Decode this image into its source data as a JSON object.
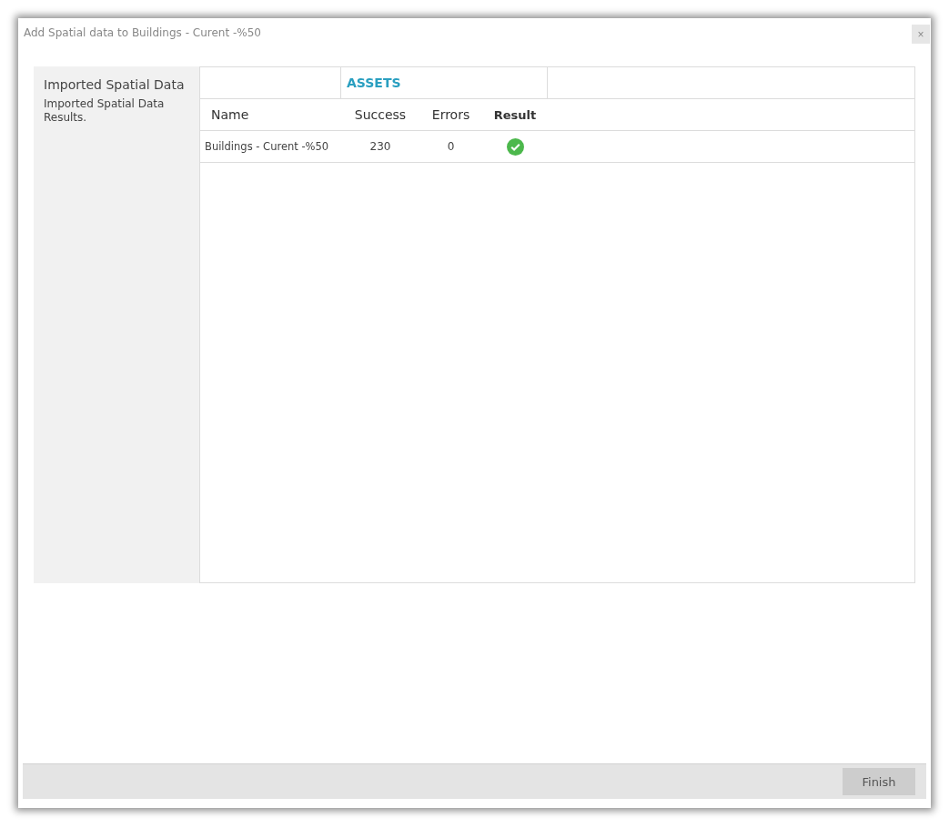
{
  "window": {
    "title": "Add Spatial data to Buildings - Curent -%50",
    "close": "×"
  },
  "sidebar": {
    "title": "Imported Spatial Data",
    "description": "Imported Spatial Data Results."
  },
  "tabs": [
    {
      "label": "ASSETS",
      "selected": true
    }
  ],
  "table": {
    "columns": [
      "Name",
      "Success",
      "Errors",
      "Result"
    ],
    "rows": [
      {
        "name": "Buildings - Curent -%50",
        "success": "230",
        "errors": "0",
        "ok": true
      }
    ]
  },
  "footer": {
    "buttons": [
      "Finish"
    ]
  }
}
